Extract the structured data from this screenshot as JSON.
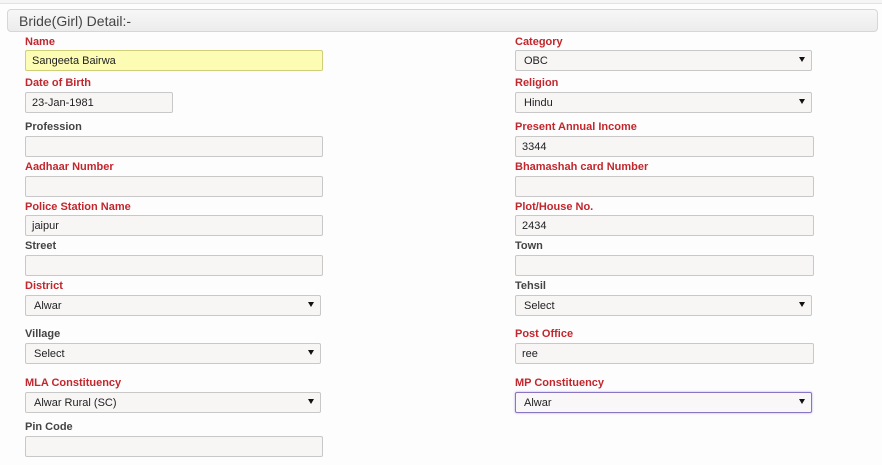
{
  "section": {
    "title": "Bride(Girl) Detail:-"
  },
  "fields": {
    "name": {
      "label": "Name",
      "value": "Sangeeta Bairwa"
    },
    "dob": {
      "label": "Date of Birth",
      "value": "23-Jan-1981"
    },
    "profession": {
      "label": "Profession",
      "value": ""
    },
    "aadhaar": {
      "label": "Aadhaar Number",
      "value": ""
    },
    "police": {
      "label": "Police Station Name",
      "value": "jaipur"
    },
    "street": {
      "label": "Street",
      "value": ""
    },
    "district": {
      "label": "District",
      "value": "Alwar"
    },
    "village": {
      "label": "Village",
      "value": "Select"
    },
    "mla": {
      "label": "MLA Constituency",
      "value": "Alwar Rural (SC)"
    },
    "pincode": {
      "label": "Pin Code",
      "value": ""
    },
    "category": {
      "label": "Category",
      "value": "OBC"
    },
    "religion": {
      "label": "Religion",
      "value": "Hindu"
    },
    "income": {
      "label": "Present Annual Income",
      "value": "3344"
    },
    "bhamashah": {
      "label": "Bhamashah card Number",
      "value": ""
    },
    "plot": {
      "label": "Plot/House No.",
      "value": "2434"
    },
    "town": {
      "label": "Town",
      "value": ""
    },
    "tehsil": {
      "label": "Tehsil",
      "value": "Select"
    },
    "postoffice": {
      "label": "Post Office",
      "value": "ree"
    },
    "mp": {
      "label": "MP Constituency",
      "value": "Alwar"
    }
  },
  "icons": {
    "dropdown": "chevron-down-icon"
  },
  "colors": {
    "required_label": "#c1272d",
    "highlight_field": "#fcfcb5",
    "focus_border": "#8a74c4"
  }
}
